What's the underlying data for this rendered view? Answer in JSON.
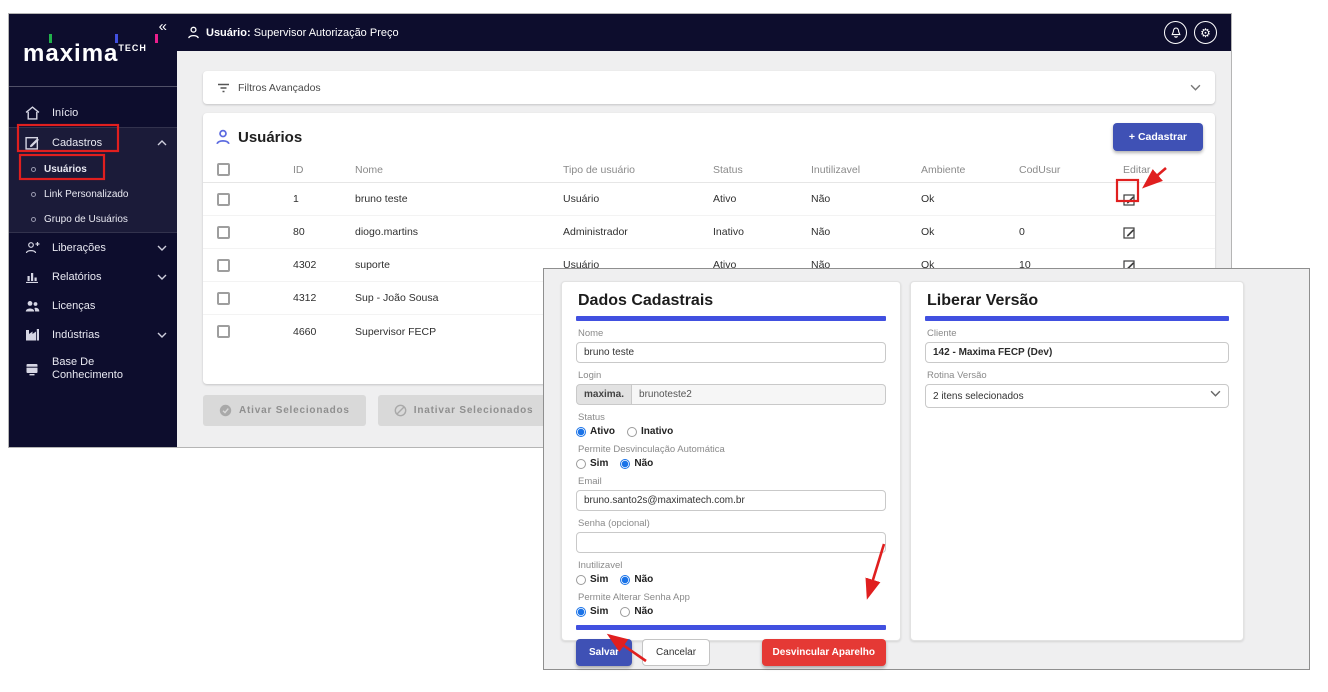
{
  "topbar": {
    "user_prefix": "Usuário:",
    "user_name": "Supervisor Autorização Preço"
  },
  "sidebar": {
    "collapse": "«",
    "logo": "maxima",
    "logo_sub": "TECH",
    "items": [
      {
        "label": "Início"
      },
      {
        "label": "Cadastros"
      },
      {
        "label": "Usuários"
      },
      {
        "label": "Link Personalizado"
      },
      {
        "label": "Grupo de Usuários"
      },
      {
        "label": "Liberações"
      },
      {
        "label": "Relatórios"
      },
      {
        "label": "Licenças"
      },
      {
        "label": "Indústrias"
      },
      {
        "label": "Base De Conhecimento"
      }
    ]
  },
  "filters": {
    "title": "Filtros Avançados"
  },
  "users": {
    "title": "Usuários",
    "add_button": "+ Cadastrar",
    "columns": [
      "ID",
      "Nome",
      "Tipo de usuário",
      "Status",
      "Inutilizavel",
      "Ambiente",
      "CodUsur",
      "Editar"
    ],
    "rows": [
      {
        "id": "1",
        "nome": "bruno teste",
        "tipo": "Usuário",
        "status": "Ativo",
        "inutilizavel": "Não",
        "ambiente": "Ok",
        "codusur": ""
      },
      {
        "id": "80",
        "nome": "diogo.martins",
        "tipo": "Administrador",
        "status": "Inativo",
        "inutilizavel": "Não",
        "ambiente": "Ok",
        "codusur": "0"
      },
      {
        "id": "4302",
        "nome": "suporte",
        "tipo": "Usuário",
        "status": "Ativo",
        "inutilizavel": "Não",
        "ambiente": "Ok",
        "codusur": "10"
      },
      {
        "id": "4312",
        "nome": "Sup - João Sousa",
        "tipo": "",
        "status": "",
        "inutilizavel": "",
        "ambiente": "",
        "codusur": ""
      },
      {
        "id": "4660",
        "nome": "Supervisor FECP",
        "tipo": "",
        "status": "",
        "inutilizavel": "",
        "ambiente": "",
        "codusur": ""
      }
    ],
    "bulk": {
      "activate": "Ativar Selecionados",
      "deactivate": "Inativar Selecionados"
    }
  },
  "modal": {
    "dados": {
      "title": "Dados Cadastrais",
      "nome_label": "Nome",
      "nome_value": "bruno teste",
      "login_label": "Login",
      "login_prefix": "maxima.",
      "login_value": "brunoteste2",
      "status_label": "Status",
      "status_opt1": "Ativo",
      "status_opt2": "Inativo",
      "desv_label": "Permite Desvinculação Automática",
      "sim": "Sim",
      "nao": "Não",
      "email_label": "Email",
      "email_value": "bruno.santo2s@maximatech.com.br",
      "senha_label": "Senha (opcional)",
      "senha_value": "",
      "inut_label": "Inutilizavel",
      "alterar_label": "Permite Alterar Senha App",
      "salvar": "Salvar",
      "cancelar": "Cancelar",
      "desvincular": "Desvincular Aparelho"
    },
    "liberar": {
      "title": "Liberar Versão",
      "cliente_label": "Cliente",
      "cliente_value": "142 - Maxima FECP (Dev)",
      "rotina_label": "Rotina Versão",
      "rotina_value": "2 itens selecionados"
    }
  },
  "colors": {
    "navy": "#0d0d2d",
    "accent_blue": "#3f51b5",
    "title_bar_blue": "#4150e0",
    "danger_red": "#e53935",
    "annotation_red": "#e01f1f",
    "selected_radio_blue": "#1a73e8"
  }
}
